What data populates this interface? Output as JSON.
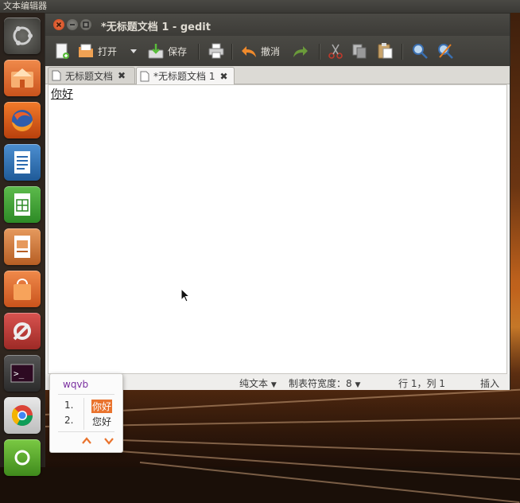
{
  "top_panel": {
    "title": "文本编辑器"
  },
  "window": {
    "title": "*无标题文档 1 - gedit"
  },
  "toolbar": {
    "open_label": "打开",
    "save_label": "保存",
    "undo_label": "撤消"
  },
  "tabs": [
    {
      "label": "无标题文档"
    },
    {
      "label": "*无标题文档 1"
    }
  ],
  "editor": {
    "content": "你好"
  },
  "statusbar": {
    "language": "纯文本",
    "tab_width": "制表符宽度：8",
    "position": "行 1，列 1",
    "mode": "插入"
  },
  "ime": {
    "code": "wqvb",
    "candidates": [
      {
        "index": "1.",
        "word": "你好"
      },
      {
        "index": "2.",
        "word": "您好"
      }
    ]
  },
  "launcher": {
    "items": [
      "ubuntu-dash",
      "home-folder",
      "firefox",
      "libreoffice-writer",
      "libreoffice-calc",
      "libreoffice-impress",
      "software-center",
      "system-settings",
      "terminal",
      "chrome",
      "another-app"
    ]
  },
  "colors": {
    "accent": "#e9732d",
    "titlebar": "#3c3b37"
  }
}
